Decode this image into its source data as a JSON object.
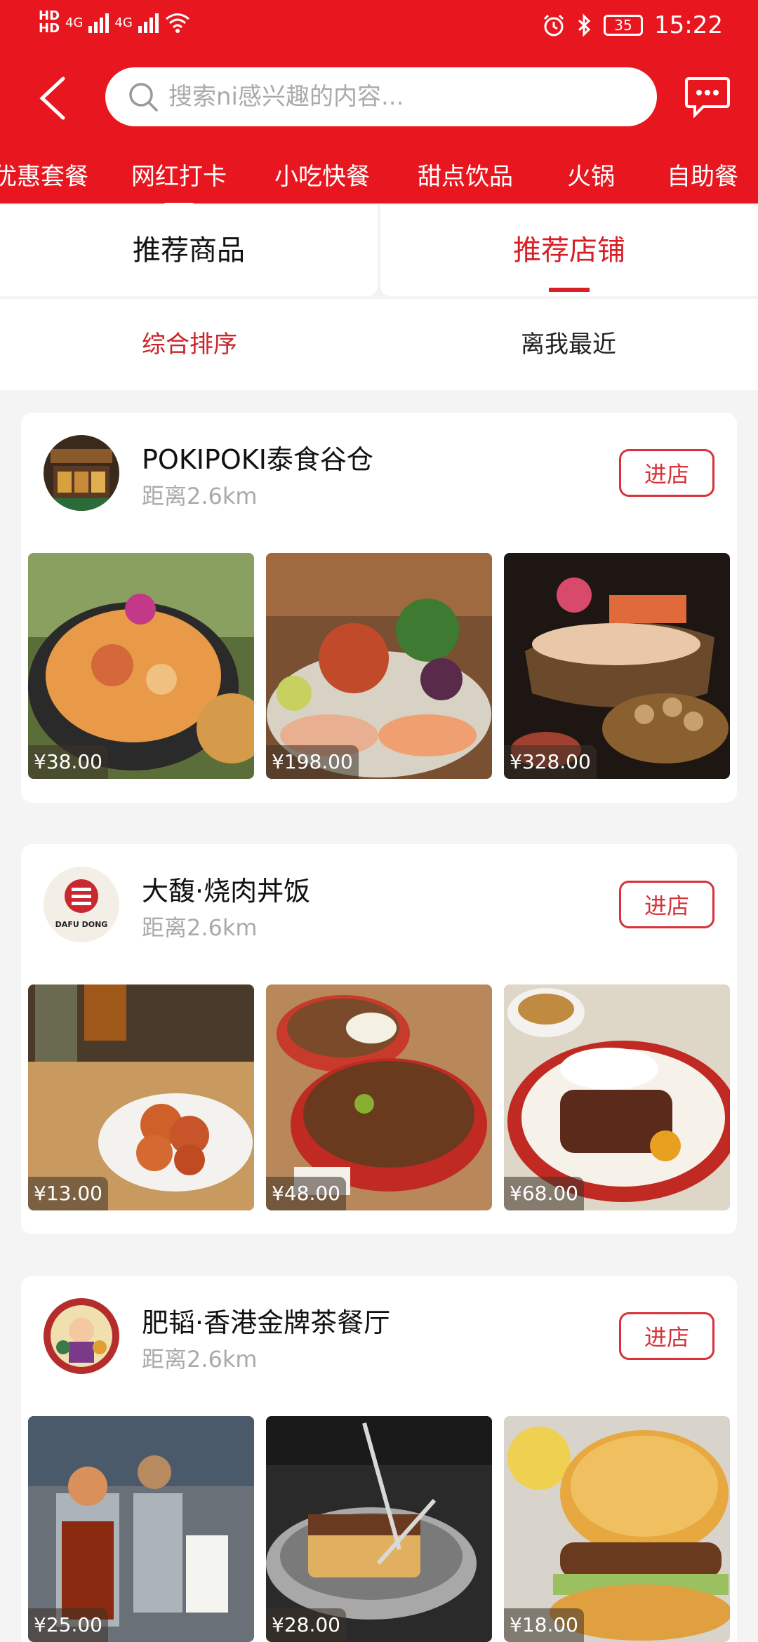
{
  "status": {
    "left_icons": "HD 4G 4G wifi",
    "net1": "4G",
    "net2": "4G",
    "battery": "35",
    "time": "15:22"
  },
  "search": {
    "placeholder": "搜索ni感兴趣的内容..."
  },
  "categories": [
    "优惠套餐",
    "网红打卡",
    "小吃快餐",
    "甜点饮品",
    "火锅",
    "自助餐"
  ],
  "active_category": "网红打卡",
  "tabs": {
    "goods": "推荐商品",
    "shops": "推荐店铺",
    "active": "推荐店铺"
  },
  "sort": {
    "general": "综合排序",
    "nearest": "离我最近",
    "active": "综合排序"
  },
  "stores": [
    {
      "name": "POKIPOKI泰食谷仓",
      "distance": "距离2.6km",
      "button": "进店",
      "prices": [
        "¥38.00",
        "¥198.00",
        "¥328.00"
      ]
    },
    {
      "name": "大馥·烧肉丼饭",
      "distance": "距离2.6km",
      "button": "进店",
      "logo_text": "DAFU DONG",
      "prices": [
        "¥13.00",
        "¥48.00",
        "¥68.00"
      ]
    },
    {
      "name": "肥韬·香港金牌茶餐厅",
      "distance": "距离2.6km",
      "button": "进店",
      "prices": [
        "¥25.00",
        "¥28.00",
        "¥18.00"
      ]
    }
  ],
  "colors": {
    "brand_red": "#e8171f",
    "accent_red": "#d81e26",
    "sort_red": "#c9252c",
    "muted": "#aaaaaa"
  },
  "icons": [
    "back-arrow-icon",
    "search-icon",
    "message-icon",
    "alarm-icon",
    "bluetooth-icon",
    "battery-icon",
    "wifi-icon",
    "signal-icon"
  ]
}
